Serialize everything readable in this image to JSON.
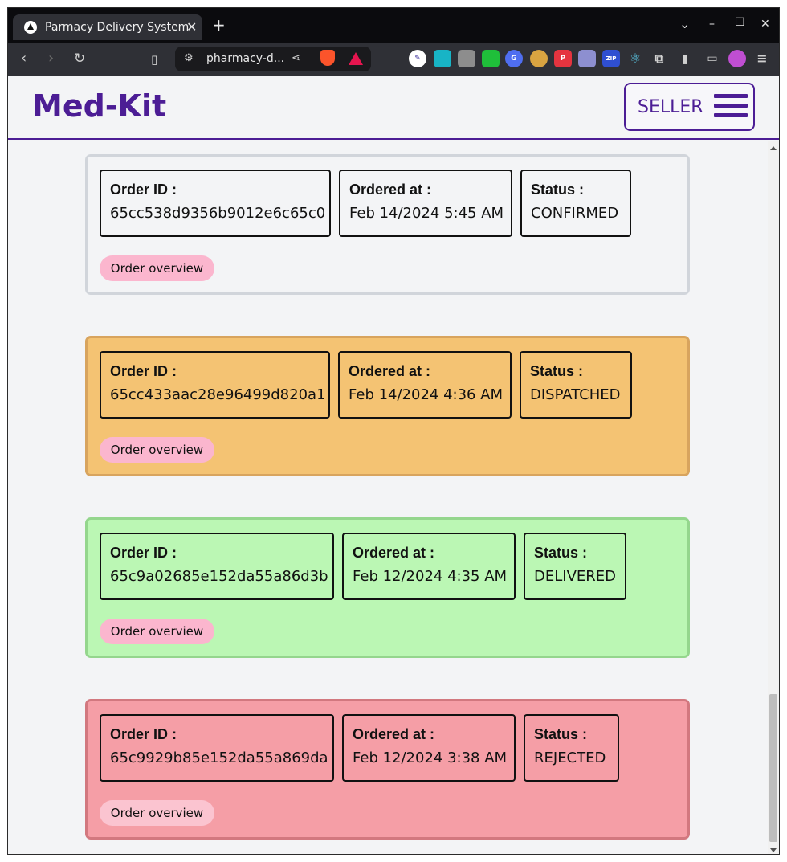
{
  "browser": {
    "tab_title": "Parmacy Delivery System",
    "tab_close": "✕",
    "new_tab": "+",
    "url": "pharmacy-d...",
    "controls": {
      "dropdown": "⌄",
      "minimize": "–",
      "maximize": "☐",
      "close": "✕"
    }
  },
  "header": {
    "logo": "Med-Kit",
    "seller_label": "SELLER"
  },
  "colors": {
    "brand": "#4c1d95",
    "confirmed_bg": "#f3f4f6",
    "dispatched_bg": "#f4c373",
    "delivered_bg": "#bbf7b4",
    "rejected_bg": "#f59ea6",
    "overview_button": "#fbb6ce"
  },
  "orders": [
    {
      "order_id_label": "Order ID :",
      "order_id": "65cc538d9356b9012e6c65c0",
      "ordered_at_label": "Ordered at :",
      "ordered_at": "Feb 14/2024 5:45 AM",
      "status_label": "Status :",
      "status": "CONFIRMED",
      "button": "Order overview"
    },
    {
      "order_id_label": "Order ID :",
      "order_id": "65cc433aac28e96499d820a1",
      "ordered_at_label": "Ordered at :",
      "ordered_at": "Feb 14/2024 4:36 AM",
      "status_label": "Status :",
      "status": "DISPATCHED",
      "button": "Order overview"
    },
    {
      "order_id_label": "Order ID :",
      "order_id": "65c9a02685e152da55a86d3b",
      "ordered_at_label": "Ordered at :",
      "ordered_at": "Feb 12/2024 4:35 AM",
      "status_label": "Status :",
      "status": "DELIVERED",
      "button": "Order overview"
    },
    {
      "order_id_label": "Order ID :",
      "order_id": "65c9929b85e152da55a869da",
      "ordered_at_label": "Ordered at :",
      "ordered_at": "Feb 12/2024 3:38 AM",
      "status_label": "Status :",
      "status": "REJECTED",
      "button": "Order overview"
    }
  ]
}
